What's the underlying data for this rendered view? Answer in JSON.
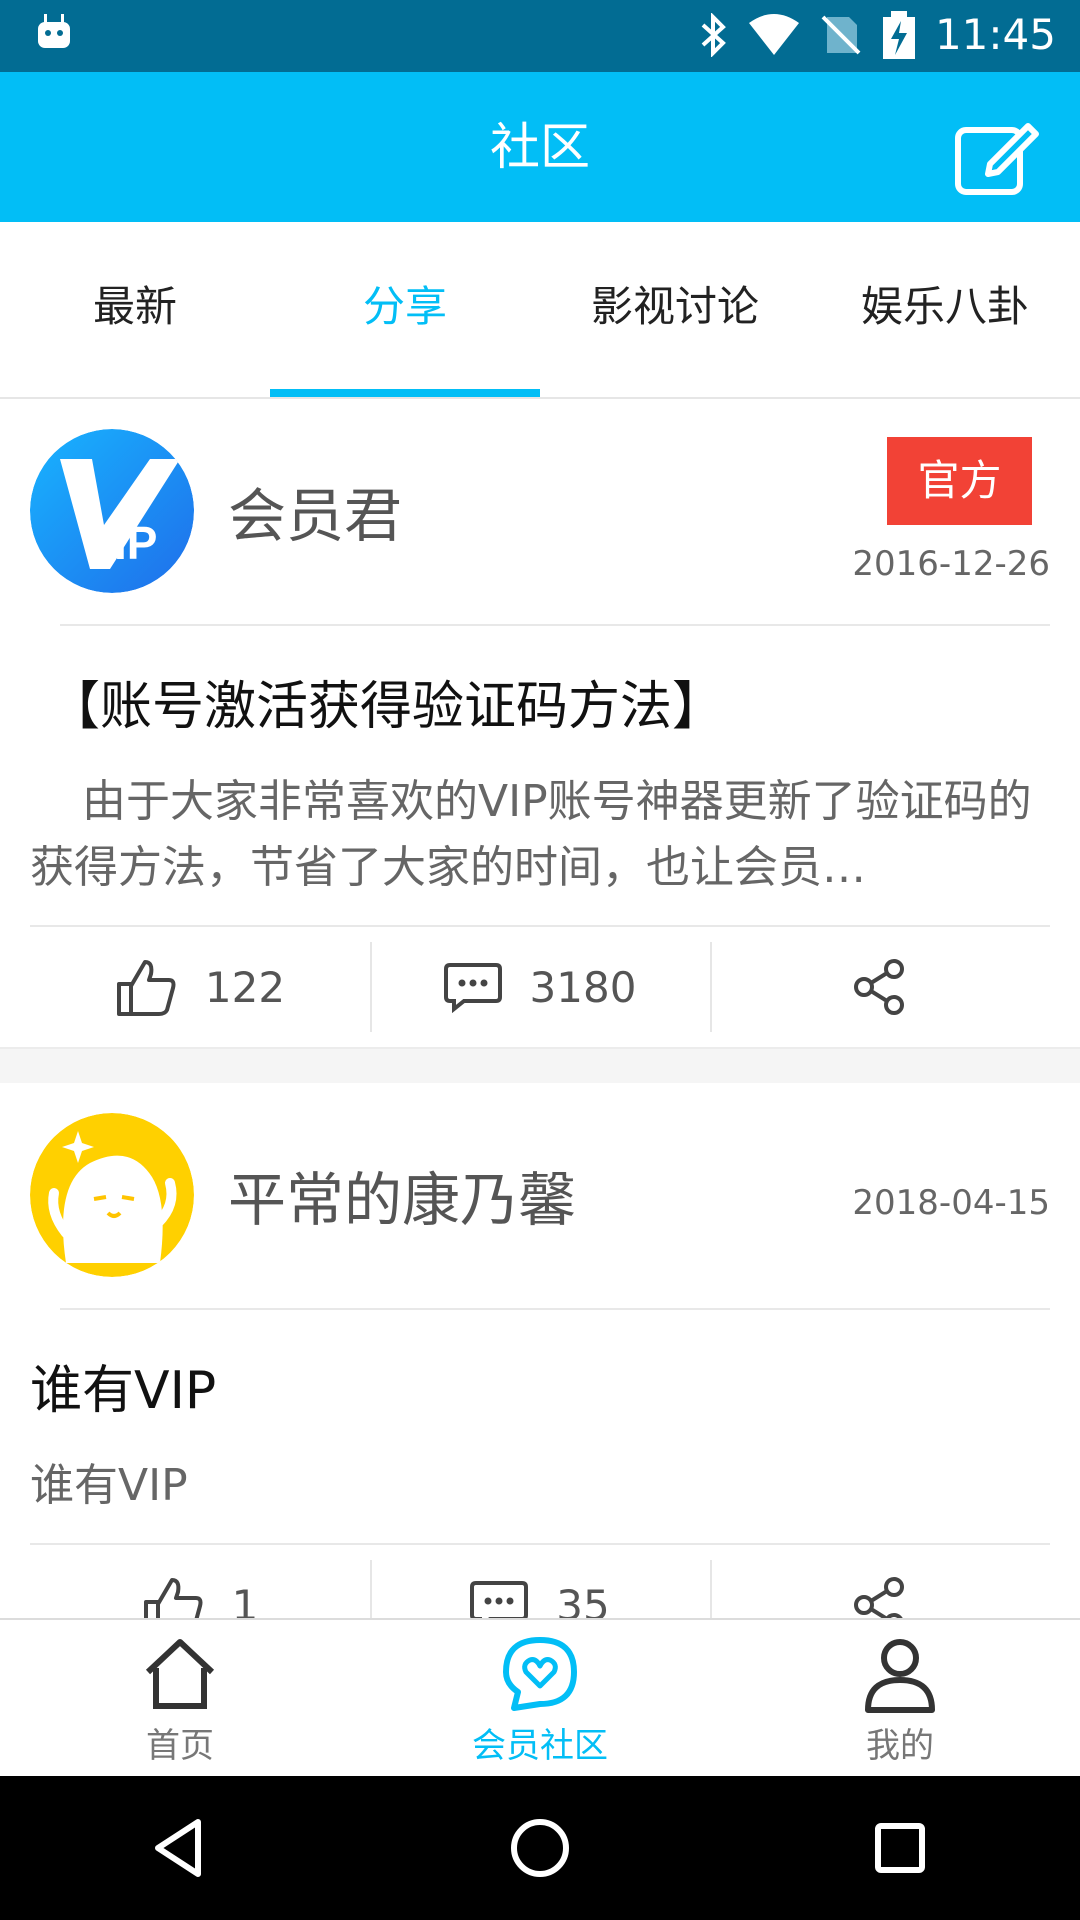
{
  "status": {
    "time": "11:45"
  },
  "appbar": {
    "title": "社区"
  },
  "tabs": [
    {
      "label": "最新"
    },
    {
      "label": "分享"
    },
    {
      "label": "影视讨论"
    },
    {
      "label": "娱乐八卦"
    }
  ],
  "posts": [
    {
      "username": "会员君",
      "badge": "官方",
      "date": "2016-12-26",
      "title": "【账号激活获得验证码方法】",
      "body": "由于大家非常喜欢的VIP账号神器更新了验证码的获得方法，节省了大家的时间，也让会员…",
      "likes": "122",
      "comments": "3180"
    },
    {
      "username": "平常的康乃馨",
      "date": "2018-04-15",
      "title": "谁有VIP",
      "body": "谁有VIP",
      "likes": "1",
      "comments": "35"
    }
  ],
  "bottom_nav": [
    {
      "label": "首页"
    },
    {
      "label": "会员社区"
    },
    {
      "label": "我的"
    }
  ],
  "colors": {
    "accent": "#02BEF6",
    "statusbar": "#026C93",
    "badge": "#F24236"
  }
}
